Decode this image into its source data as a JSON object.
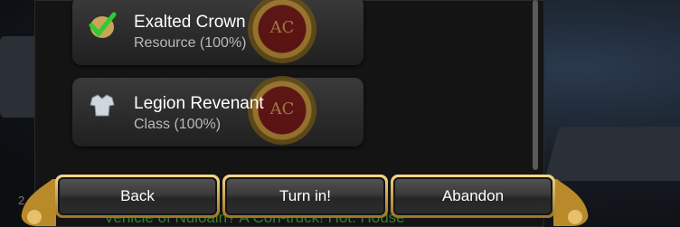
{
  "items": [
    {
      "title": "Exalted Crown",
      "subtitle": "Resource (100%)",
      "icon": "check-icon",
      "coin_text": "AC"
    },
    {
      "title": "Legion Revenant",
      "subtitle": "Class (100%)",
      "icon": "armor-icon",
      "coin_text": "AC"
    }
  ],
  "buttons": {
    "back": "Back",
    "turn_in": "Turn in!",
    "abandon": "Abandon"
  },
  "footer_text": "Vehicle of Nuloain? A Corl-truck! Hot. House",
  "corner_number": "2",
  "colors": {
    "gold": "#d6ad52",
    "footer_green": "#3b7a2e",
    "title": "#ffffff",
    "subtitle": "#b9b9b9"
  }
}
